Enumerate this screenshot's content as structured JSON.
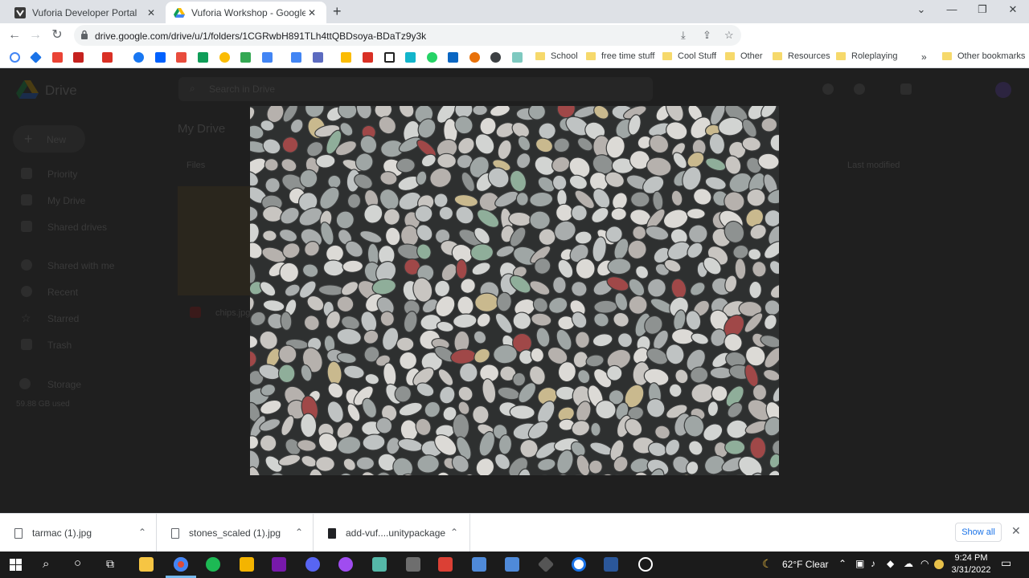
{
  "browser": {
    "tabs": [
      {
        "title": "Vuforia Developer Portal",
        "active": false
      },
      {
        "title": "Vuforia Workshop - Google Drive",
        "active": true
      }
    ],
    "url": "drive.google.com/drive/u/1/folders/1CGRwbH891TLh4ttQBDsoya-BDaTz9y3k"
  },
  "bookmarks": {
    "folders": [
      "School",
      "free time stuff",
      "Cool Stuff",
      "Other",
      "Resources",
      "Roleplaying"
    ],
    "overflow": "»",
    "other": "Other bookmarks"
  },
  "drive_background": {
    "app_name": "Drive",
    "search_placeholder": "Search in Drive",
    "new_button": "New",
    "nav": [
      "Priority",
      "My Drive",
      "Shared drives",
      "Shared with me",
      "Recent",
      "Starred",
      "Trash",
      "Storage"
    ],
    "storage_used": "59.88 GB used",
    "breadcrumb": "My Drive",
    "files_label": "Files",
    "sort_label": "Last modified",
    "file_name": "chips.jpg"
  },
  "preview": {
    "image": "gray-pebble-stones-photo"
  },
  "downloads": {
    "items": [
      "tarmac (1).jpg",
      "stones_scaled (1).jpg",
      "add-vuf....unitypackage"
    ],
    "show_all": "Show all"
  },
  "taskbar": {
    "weather": "62°F  Clear",
    "time": "9:24 PM",
    "date": "3/31/2022"
  },
  "colors": {
    "chrome_tabstrip": "#dee1e6",
    "drive_overlay": "#1f1f1f",
    "taskbar": "#1b1b1b",
    "link_blue": "#1a73e8"
  }
}
